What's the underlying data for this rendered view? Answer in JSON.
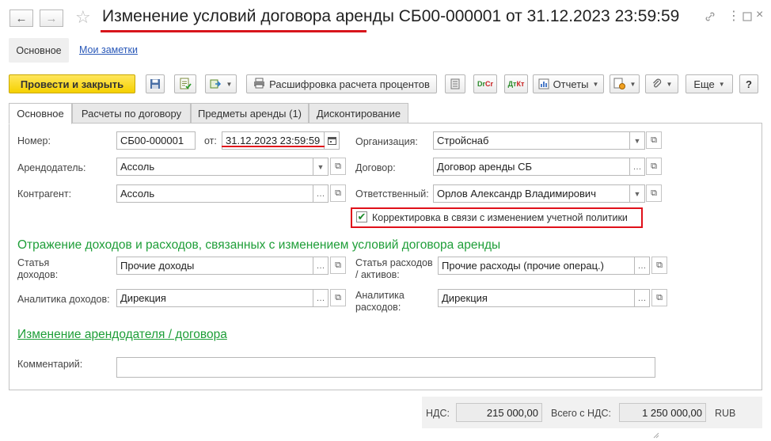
{
  "window": {
    "title": "Изменение условий договора аренды СБ00-000001 от 31.12.2023 23:59:59"
  },
  "nav": {
    "main": "Основное",
    "notes": "Мои заметки"
  },
  "toolbar": {
    "post_and_close": "Провести и закрыть",
    "interest_breakdown": "Расшифровка расчета процентов",
    "dt_label": "Dr",
    "ct_label": "Cr",
    "dt_ru": "Дт",
    "ct_ru": "Кт",
    "reports": "Отчеты",
    "more": "Еще",
    "help": "?"
  },
  "tabs": [
    {
      "label": "Основное",
      "active": true
    },
    {
      "label": "Расчеты по договору",
      "active": false
    },
    {
      "label": "Предметы аренды (1)",
      "active": false
    },
    {
      "label": "Дисконтирование",
      "active": false
    }
  ],
  "form": {
    "number_label": "Номер:",
    "number_value": "СБ00-000001",
    "date_from_label": "от:",
    "date_value": "31.12.2023 23:59:59",
    "org_label": "Организация:",
    "org_value": "Стройснаб",
    "lessor_label": "Арендодатель:",
    "lessor_value": "Ассоль",
    "contract_label": "Договор:",
    "contract_value": "Договор аренды СБ",
    "counterparty_label": "Контрагент:",
    "counterparty_value": "Ассоль",
    "responsible_label": "Ответственный:",
    "responsible_value": "Орлов Александр Владимирович",
    "policy_checkbox_label": "Корректировка в связи с изменением учетной политики",
    "policy_checked": true
  },
  "income_section": {
    "title": "Отражение доходов и расходов, связанных с изменением условий договора аренды",
    "income_item_label_1": "Статья",
    "income_item_label_2": "доходов:",
    "income_item_value": "Прочие доходы",
    "expense_item_label_1": "Статья расходов",
    "expense_item_label_2": "/ активов:",
    "expense_item_value": "Прочие расходы (прочие операц.)",
    "income_analytics_label": "Аналитика доходов:",
    "income_analytics_value": "Дирекция",
    "expense_analytics_label_1": "Аналитика",
    "expense_analytics_label_2": "расходов:",
    "expense_analytics_value": "Дирекция"
  },
  "change_link": "Изменение арендодателя / договора",
  "comment_label": "Комментарий:",
  "comment_value": "",
  "footer": {
    "vat_label": "НДС:",
    "vat_value": "215 000,00",
    "total_label": "Всего с НДС:",
    "total_value": "1 250 000,00",
    "currency": "RUB"
  },
  "colors": {
    "primary_button": "#f5d100",
    "section_green": "#1e9e38",
    "link_blue": "#2958b8",
    "highlight_red": "#e0101a"
  }
}
